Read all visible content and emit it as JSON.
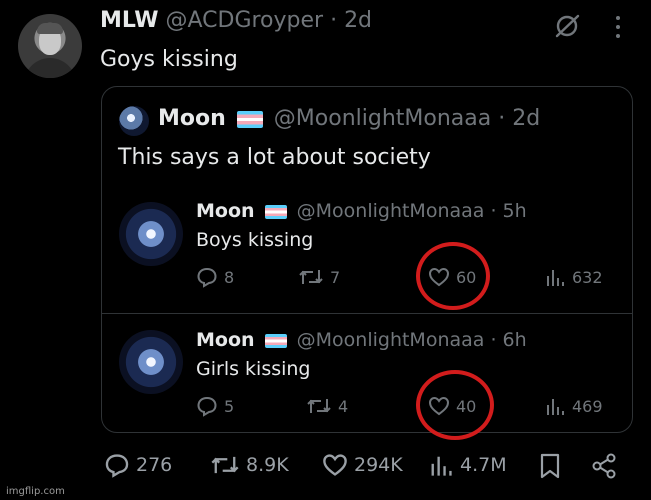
{
  "tweet": {
    "display_name": "MLW",
    "handle_time": "@ACDGroyper · 2d",
    "text": "Goys kissing"
  },
  "quote": {
    "display_name": "Moon",
    "handle_time": "@MoonlightMonaaa · 2d",
    "text": "This says a lot about society"
  },
  "embedded": [
    {
      "display_name": "Moon",
      "handle_time": "@MoonlightMonaaa · 5h",
      "text": "Boys kissing",
      "replies": "8",
      "reposts": "7",
      "likes": "60",
      "views": "632"
    },
    {
      "display_name": "Moon",
      "handle_time": "@MoonlightMonaaa · 6h",
      "text": "Girls kissing",
      "replies": "5",
      "reposts": "4",
      "likes": "40",
      "views": "469"
    }
  ],
  "actions": {
    "replies": "276",
    "reposts": "8.9K",
    "likes": "294K",
    "views": "4.7M"
  },
  "watermark": "imgflip.com",
  "colors": {
    "annotation_circle": "#d21c1c",
    "muted": "#71767b",
    "text": "#e7e9ea"
  }
}
